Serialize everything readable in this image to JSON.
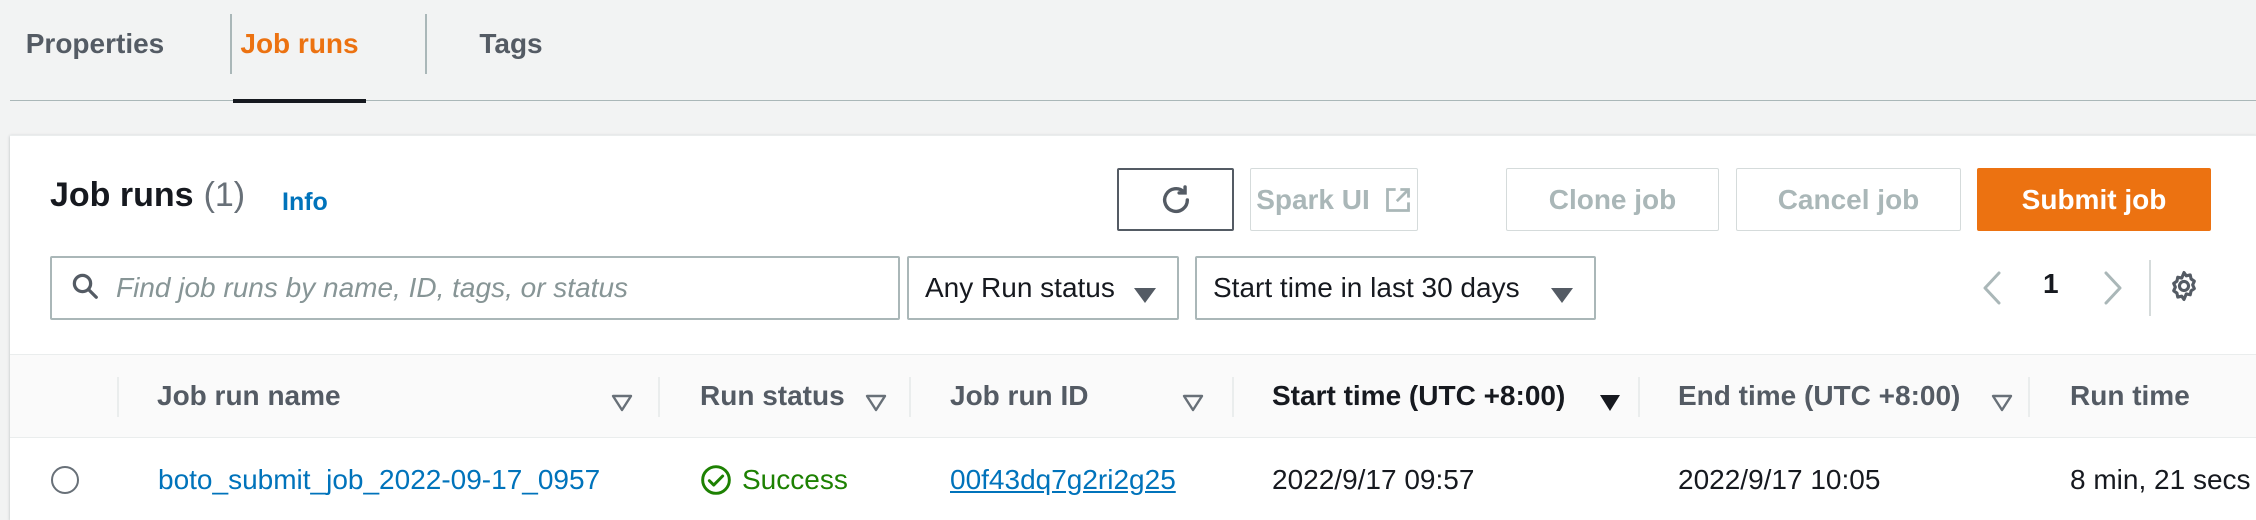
{
  "tabs": [
    {
      "label": "Properties",
      "active": false
    },
    {
      "label": "Job runs",
      "active": true
    },
    {
      "label": "Tags",
      "active": false
    }
  ],
  "panel": {
    "title": "Job runs",
    "count": "(1)",
    "info_label": "Info"
  },
  "toolbar": {
    "refresh_icon": "refresh-icon",
    "spark_ui_label": "Spark UI",
    "spark_ui_icon": "external-link-icon",
    "clone_label": "Clone job",
    "cancel_label": "Cancel job",
    "submit_label": "Submit job"
  },
  "filters": {
    "search_placeholder": "Find job runs by name, ID, tags, or status",
    "search_value": "",
    "status_filter": "Any Run status",
    "time_filter": "Start time in last 30 days"
  },
  "pagination": {
    "current_page": "1"
  },
  "table": {
    "columns": [
      "Job run name",
      "Run status",
      "Job run ID",
      "Start time (UTC +8:00)",
      "End time (UTC +8:00)",
      "Run time"
    ],
    "sorted_column": "Start time (UTC +8:00)",
    "rows": [
      {
        "name": "boto_submit_job_2022-09-17_0957",
        "status": "Success",
        "run_id": "00f43dq7g2ri2g25",
        "start_time": "2022/9/17 09:57",
        "end_time": "2022/9/17 10:05",
        "run_time": "8 min, 21 secs"
      }
    ]
  },
  "colors": {
    "accent": "#ec7211",
    "link": "#0073bb",
    "success": "#1d8102",
    "text": "#16191f",
    "muted": "#545b64"
  }
}
